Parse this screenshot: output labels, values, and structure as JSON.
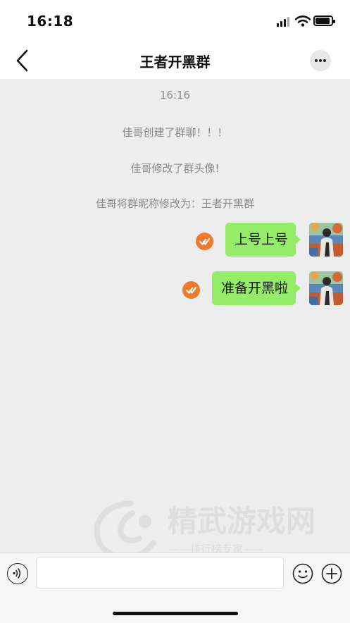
{
  "status_bar": {
    "time": "16:18"
  },
  "nav": {
    "title": "王者开黑群"
  },
  "chat": {
    "timestamp": "16:16",
    "system_messages": [
      "佳哥创建了群聊！！！",
      "佳哥修改了群头像!",
      "佳哥将群昵称修改为：王者开黑群"
    ],
    "messages": [
      {
        "text": "上号上号",
        "status": "sent"
      },
      {
        "text": "准备开黑啦",
        "status": "sent"
      }
    ]
  },
  "watermark": {
    "brand": "精武游戏网",
    "tagline": "——排行榜专家——"
  },
  "input_bar": {
    "text": "",
    "placeholder": ""
  },
  "colors": {
    "bubble": "#95ec69",
    "check": "#f07a2c",
    "background": "#ededed"
  },
  "icons": [
    "back-arrow-icon",
    "more-icon",
    "check-icon",
    "voice-icon",
    "emoji-icon",
    "plus-icon"
  ]
}
